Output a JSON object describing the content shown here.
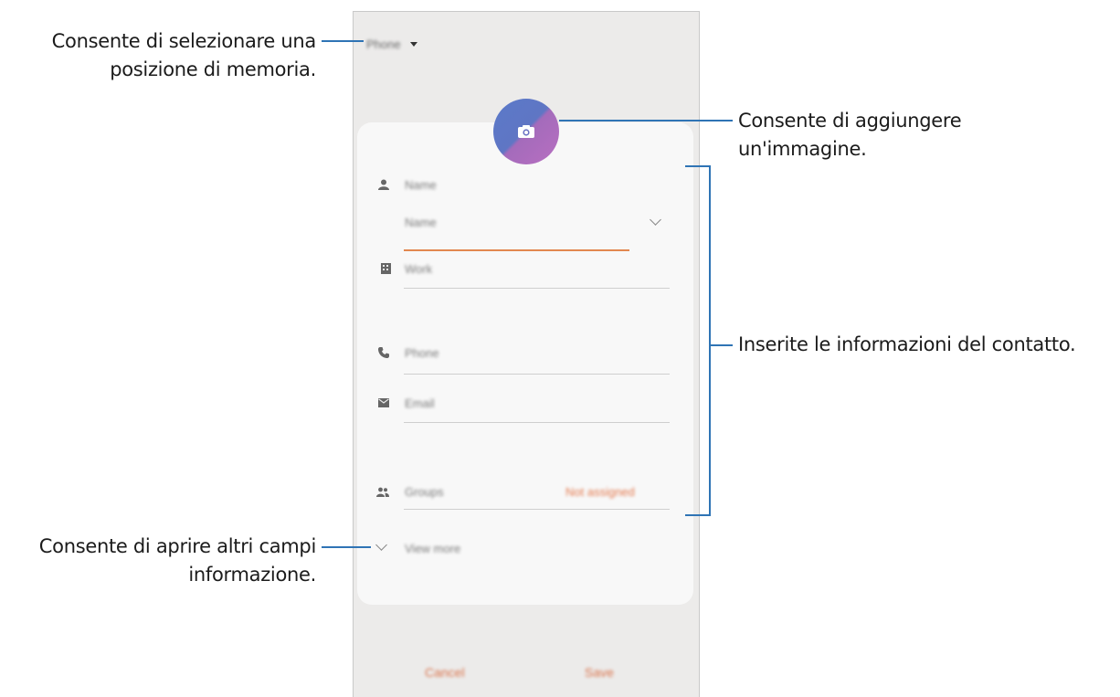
{
  "phone": {
    "storage_label": "Phone",
    "fields": {
      "name_header": "Name",
      "name_input": "Name",
      "work": "Work",
      "phone": "Phone",
      "email": "Email",
      "groups": "Groups",
      "groups_value": "Not assigned",
      "view_more": "View more"
    },
    "buttons": {
      "cancel": "Cancel",
      "save": "Save"
    },
    "colors": {
      "accent": "#e2874f",
      "avatar_start": "#5b79c9",
      "avatar_end": "#b86fc1"
    }
  },
  "callouts": {
    "storage_line1": "Consente di selezionare una",
    "storage_line2": "posizione di memoria.",
    "image_line1": "Consente di aggiungere",
    "image_line2": "un'immagine.",
    "info": "Inserite le informazioni del contatto.",
    "more_line1": "Consente di aprire altri campi",
    "more_line2": "informazione."
  }
}
